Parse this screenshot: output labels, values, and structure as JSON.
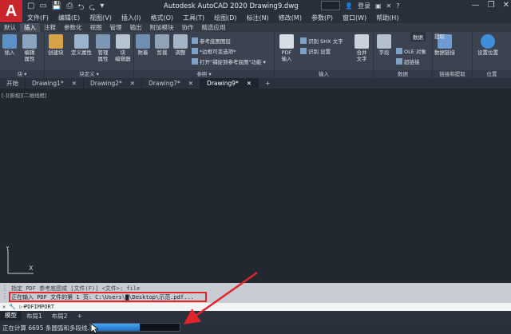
{
  "app": {
    "logo_letter": "A",
    "title": "Autodesk AutoCAD 2020    Drawing9.dwg",
    "login": "登录",
    "qat": [
      "▢",
      "▭",
      "💾",
      "⎙",
      "⮌",
      "⮎",
      "▾"
    ],
    "window_controls": [
      "—",
      "❐",
      "✕"
    ]
  },
  "menubar": {
    "items": [
      "文件(F)",
      "编辑(E)",
      "视图(V)",
      "插入(I)",
      "格式(O)",
      "工具(T)",
      "绘图(D)",
      "标注(N)",
      "修改(M)",
      "参数(P)",
      "窗口(W)",
      "帮助(H)"
    ]
  },
  "ribbon_tabs": {
    "items": [
      "默认",
      "插入",
      "注释",
      "参数化",
      "视图",
      "管理",
      "输出",
      "附加模块",
      "协作",
      "精选应用"
    ],
    "active_index": 1
  },
  "ribbon": {
    "block": {
      "insert": "插入",
      "edit_attr": "编辑\n属性",
      "footer": "块 ▾"
    },
    "block_def": {
      "create": "创建块",
      "define_attr": "定义属性",
      "manage_attr": "管理\n属性",
      "block_editor": "块\n编辑器",
      "footer": "块定义 ▾"
    },
    "reference": {
      "attach": "附着",
      "clip": "剪裁",
      "adjust": "调整",
      "underlay_layers": "参考底图图层",
      "frames": "*边框可变选项*",
      "snap": "打开\"捕捉到参考底图\"功能 ▾",
      "footer": "参照 ▾"
    },
    "import": {
      "pdf": "PDF\n输入",
      "recognize_shx": "识别 SHX 文字",
      "recognize_settings": "识别 设置",
      "merge_text": "合并\n文字",
      "footer": "输入"
    },
    "data": {
      "field": "字段",
      "ole": "OLE 对象",
      "hyperlink": "超链接",
      "footer": "数据"
    },
    "linking": {
      "data_link": "数据链接",
      "tooltip": "数据",
      "extract": "提取",
      "footer": "链接和提取"
    },
    "location": {
      "set_location": "设置位置",
      "footer": "位置"
    }
  },
  "doc_tabs": {
    "items": [
      {
        "label": "开始",
        "close": ""
      },
      {
        "label": "Drawing1*",
        "close": "✕"
      },
      {
        "label": "Drawing2*",
        "close": "✕"
      },
      {
        "label": "Drawing7*",
        "close": "✕"
      },
      {
        "label": "Drawing9*",
        "close": "✕"
      }
    ],
    "active_index": 4,
    "add_label": "+"
  },
  "canvas": {
    "viewport_label": "[-][俯视][二维线框]",
    "ucs_y": "Y",
    "ucs_x": "X"
  },
  "command": {
    "history_line1": "指定 PDF 参考底图或 [文件(F)] <文件>:  file",
    "history_line2": "正在输入 PDF 文件的第 1 页: C:\\Users\\▇\\Desktop\\示范.pdf...",
    "input_icon": "✕ 🔧 ▷▾",
    "input_text": "PDFIMPORT"
  },
  "layout_tabs": {
    "items": [
      "模型",
      "布局1",
      "布局2"
    ],
    "active_index": 0,
    "add_label": "+"
  },
  "statusbar": {
    "text": "正在计算 6695 条圆弧和多段线...",
    "progress": 0.55
  },
  "colors": {
    "highlight": "#e0262c",
    "accent": "#1c6fc4",
    "logo": "#c8252c"
  }
}
